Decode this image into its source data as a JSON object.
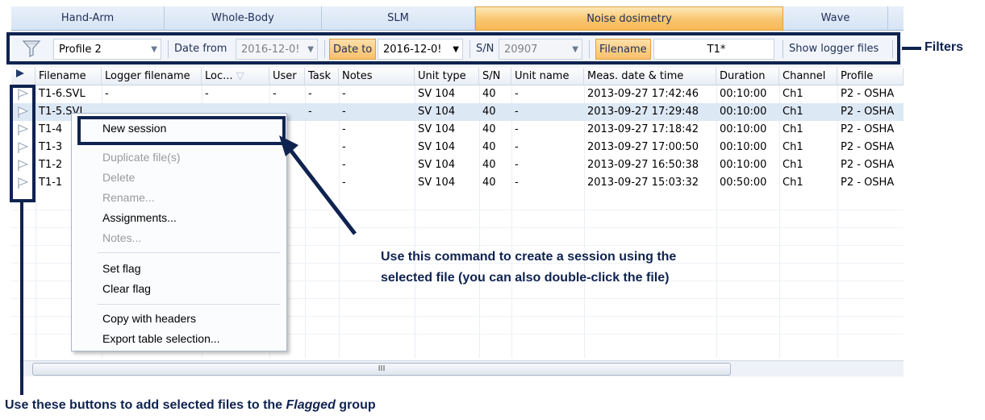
{
  "tabs": [
    {
      "label": "Hand-Arm",
      "active": false
    },
    {
      "label": "Whole-Body",
      "active": false
    },
    {
      "label": "SLM",
      "active": false
    },
    {
      "label": "Noise dosimetry",
      "active": true
    },
    {
      "label": "Wave",
      "active": false
    }
  ],
  "toolbar": {
    "profile_value": "Profile 2",
    "date_from_label": "Date from",
    "date_from_value": "2016-12-0!",
    "date_to_label": "Date to",
    "date_to_value": "2016-12-0!",
    "sn_label": "S/N",
    "sn_value": "20907",
    "filename_label": "Filename",
    "filename_value": "T1*",
    "show_logger_label": "Show logger files"
  },
  "columns": [
    "Filename",
    "Logger filename",
    "Loc...",
    "User",
    "Task",
    "Notes",
    "Unit type",
    "S/N",
    "Unit name",
    "Meas. date & time",
    "Duration",
    "Channel",
    "Profile"
  ],
  "rows": [
    [
      "T1-6.SVL",
      "-",
      "-",
      "-",
      "-",
      "-",
      "SV 104",
      "40",
      "-",
      "2013-09-27 17:42:46",
      "00:10:00",
      "Ch1",
      "P2 - OSHA"
    ],
    [
      "T1-5.SVL",
      "",
      "",
      "",
      "-",
      "-",
      "SV 104",
      "40",
      "-",
      "2013-09-27 17:29:48",
      "00:10:00",
      "Ch1",
      "P2 - OSHA"
    ],
    [
      "T1-4",
      "",
      "",
      "-",
      "",
      "-",
      "SV 104",
      "40",
      "-",
      "2013-09-27 17:18:42",
      "00:10:00",
      "Ch1",
      "P2 - OSHA"
    ],
    [
      "T1-3",
      "",
      "",
      "-",
      "",
      "-",
      "SV 104",
      "40",
      "-",
      "2013-09-27 17:00:50",
      "00:10:00",
      "Ch1",
      "P2 - OSHA"
    ],
    [
      "T1-2",
      "",
      "",
      "-",
      "",
      "-",
      "SV 104",
      "40",
      "-",
      "2013-09-27 16:50:38",
      "00:10:00",
      "Ch1",
      "P2 - OSHA"
    ],
    [
      "T1-1",
      "",
      "",
      "-",
      "",
      "-",
      "SV 104",
      "40",
      "-",
      "2013-09-27 15:03:32",
      "00:50:00",
      "Ch1",
      "P2 - OSHA"
    ]
  ],
  "context_menu": {
    "new_session": "New session",
    "duplicate": "Duplicate file(s)",
    "delete": "Delete",
    "rename": "Rename...",
    "assignments": "Assignments...",
    "notes": "Notes...",
    "set_flag": "Set flag",
    "clear_flag": "Clear flag",
    "copy_headers": "Copy with headers",
    "export": "Export table selection..."
  },
  "annotations": {
    "filters": "Filters",
    "new_session_line1": "Use this command to create a session using the",
    "new_session_line2": "selected file (you can also double-click the file)",
    "flag_prefix": "Use these buttons to add selected files to the ",
    "flag_italic": "Flagged",
    "flag_suffix": " group"
  },
  "scroll_glyph": "III",
  "colors": {
    "annotation": "#0f2350",
    "active_tab": "#f8c56e",
    "selected_row": "#dde8f5"
  }
}
